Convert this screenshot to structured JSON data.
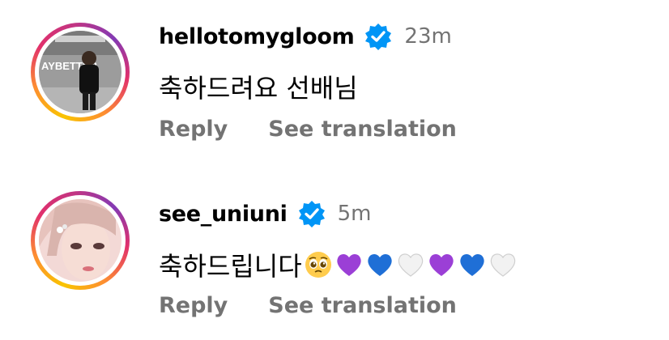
{
  "comments": [
    {
      "username": "hellotomygloom",
      "verified": true,
      "time": "23m",
      "text": "축하드려요 선배님",
      "emojis": [],
      "avatar_sign_text": "AYBETTER",
      "reply_label": "Reply",
      "translate_label": "See translation"
    },
    {
      "username": "see_uniuni",
      "verified": true,
      "time": "5m",
      "text": "축하드립니다",
      "emojis": [
        "pleading-face",
        "purple-heart",
        "blue-heart",
        "white-heart",
        "purple-heart",
        "blue-heart",
        "white-heart"
      ],
      "reply_label": "Reply",
      "translate_label": "See translation"
    }
  ],
  "colors": {
    "verified_badge": "#0095f6",
    "secondary_text": "#737373",
    "purple_heart": "#9b3fd6",
    "blue_heart": "#1f6fd6",
    "white_heart": "#f2f2f2"
  }
}
